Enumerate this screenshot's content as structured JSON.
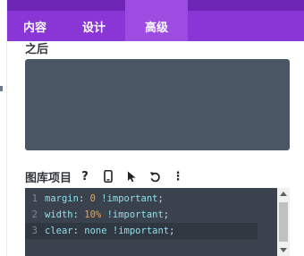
{
  "tabs": [
    {
      "label": "内容"
    },
    {
      "label": "设计"
    },
    {
      "label": "高级"
    }
  ],
  "active_tab": "高级",
  "after_label": "之后",
  "after_value": "",
  "library": {
    "label": "图库项目",
    "tools": {
      "help": "?",
      "mobile": "mobile-icon",
      "pointer": "cursor-icon",
      "undo": "undo-icon",
      "more": "⋮"
    }
  },
  "code": {
    "lines": [
      {
        "n": "1",
        "prop": "margin",
        "colon": ":",
        "val": "0",
        "imp": "!important",
        "semi": ";"
      },
      {
        "n": "2",
        "prop": "width",
        "colon": ":",
        "val": "10%",
        "imp": "!important",
        "semi": ";"
      },
      {
        "n": "3",
        "prop": "clear",
        "colon": ":",
        "val": "none",
        "imp": "!important",
        "semi": ";"
      }
    ]
  },
  "colors": {
    "tab_bar": "#8a35d6",
    "tab_active": "#9c4ce0",
    "editor_bg": "#39424d",
    "after_box": "#4a5663"
  }
}
